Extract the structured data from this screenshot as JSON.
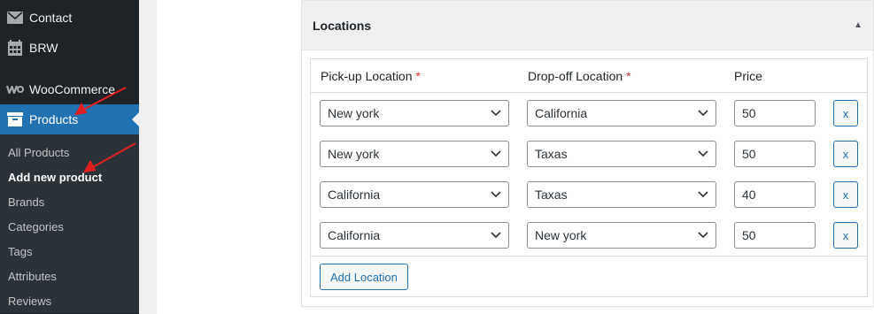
{
  "sidebar": {
    "items": [
      {
        "label": "Contact",
        "icon": "mail-icon"
      },
      {
        "label": "BRW",
        "icon": "calendar-icon"
      },
      {
        "label": "WooCommerce",
        "icon": "woocommerce-icon"
      },
      {
        "label": "Products",
        "icon": "archive-icon",
        "current": true
      }
    ],
    "submenu": [
      {
        "label": "All Products"
      },
      {
        "label": "Add new product",
        "current": true
      },
      {
        "label": "Brands"
      },
      {
        "label": "Categories"
      },
      {
        "label": "Tags"
      },
      {
        "label": "Attributes"
      },
      {
        "label": "Reviews"
      }
    ]
  },
  "postbox": {
    "title": "Locations",
    "toggle_icon": "▲"
  },
  "table": {
    "headers": {
      "pickup": "Pick-up Location",
      "dropoff": "Drop-off Location",
      "price": "Price",
      "required_mark": "*"
    },
    "rows": [
      {
        "pickup": "New york",
        "dropoff": "California",
        "price": "50",
        "remove": "x"
      },
      {
        "pickup": "New york",
        "dropoff": "Taxas",
        "price": "50",
        "remove": "x"
      },
      {
        "pickup": "California",
        "dropoff": "Taxas",
        "price": "40",
        "remove": "x"
      },
      {
        "pickup": "California",
        "dropoff": "New york",
        "price": "50",
        "remove": "x"
      }
    ],
    "add_button": "Add Location"
  },
  "colors": {
    "sidebar_bg": "#1d2327",
    "accent": "#2271b1",
    "required": "#d63638",
    "annotation_arrow": "#e02020"
  }
}
